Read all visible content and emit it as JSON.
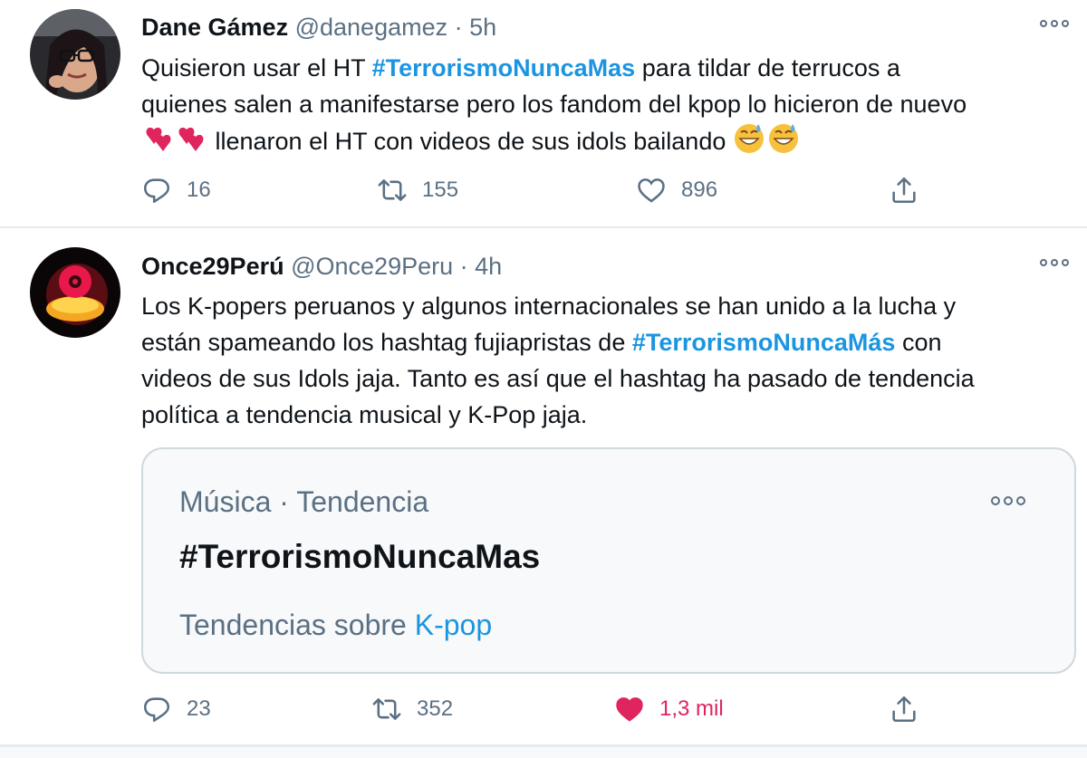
{
  "tweets": [
    {
      "name": "Dane Gámez",
      "handle": "@danegamez",
      "separator": "·",
      "time": "5h",
      "text": {
        "part1": "Quisieron usar el HT ",
        "hashtag": "#TerrorismoNuncaMas",
        "part2": " para tildar de terrucos a",
        "line2": "quienes salen a manifestarse pero los fandom del kpop lo hicieron de nuevo",
        "line3": " llenaron el HT con videos de sus idols bailando "
      },
      "replies": "16",
      "retweets": "155",
      "likes": "896"
    },
    {
      "name": "Once29Perú",
      "handle": "@Once29Peru",
      "separator": "·",
      "time": "4h",
      "text": {
        "line1": "Los K-popers peruanos y algunos internacionales se han unido a la lucha y",
        "line2a": "están spameando los hashtag fujiapristas de ",
        "hashtag": "#TerrorismoNuncaMás",
        "line2b": " con",
        "line3": "videos de sus Idols jaja. Tanto es así que el hashtag ha pasado de tendencia",
        "line4": "política a tendencia musical y K-Pop jaja."
      },
      "card": {
        "meta": "Música · Tendencia",
        "title": "#TerrorismoNuncaMas",
        "sub_prefix": "Tendencias sobre",
        "sub_link": "K-pop"
      },
      "replies": "23",
      "retweets": "352",
      "likes": "1,3 mil",
      "liked": true
    }
  ],
  "colors": {
    "hashtag": "#1b95e0",
    "secondary": "#5b7083",
    "like_active": "#e0245e",
    "border": "#e6ecf0"
  },
  "icons": [
    "reply-icon",
    "retweet-icon",
    "like-icon",
    "share-icon",
    "more-icon"
  ]
}
